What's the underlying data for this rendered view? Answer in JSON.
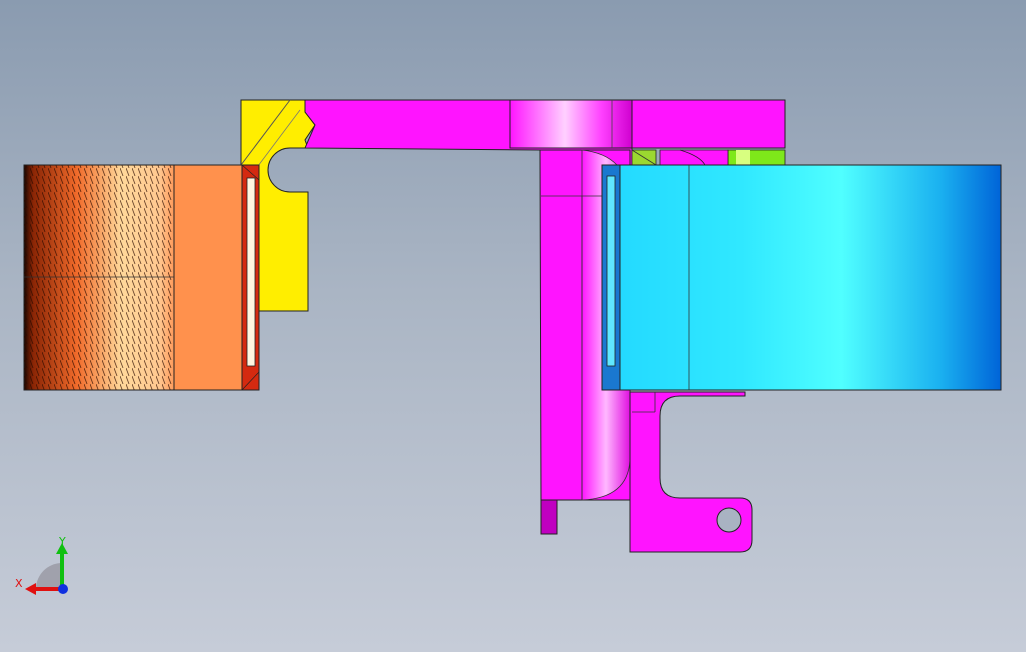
{
  "view": {
    "background_top": "#8a9bb0",
    "background_bottom": "#c6ccd8"
  },
  "parts": [
    {
      "name": "yellow-clamp-part",
      "color": "#ffee00"
    },
    {
      "name": "magenta-bracket-part",
      "color": "#ff14ff"
    },
    {
      "name": "orange-motor-part",
      "color": "#ff914d"
    },
    {
      "name": "cyan-motor-part",
      "color": "#22d8ff"
    },
    {
      "name": "green-insert-part",
      "color": "#7ee81a"
    }
  ],
  "triad": {
    "x_label": "X",
    "y_label": "Y",
    "x_color": "#e01010",
    "y_color": "#10c010",
    "z_color": "#1030e0"
  }
}
